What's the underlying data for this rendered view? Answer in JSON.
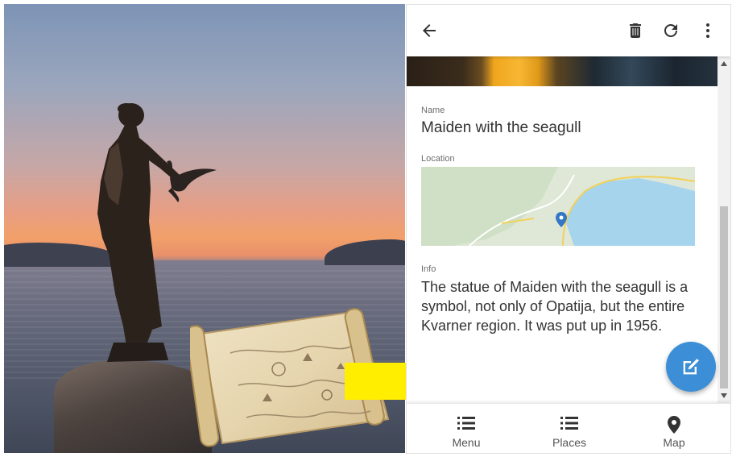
{
  "app": {
    "toolbar": {
      "back_icon": "arrow-left-icon",
      "delete_icon": "trash-icon",
      "refresh_icon": "refresh-icon",
      "more_icon": "more-vertical-icon"
    },
    "details": {
      "name_label": "Name",
      "name_value": "Maiden with the seagull",
      "location_label": "Location",
      "info_label": "Info",
      "info_text": "The statue of Maiden with the seagull is a symbol, not only of Opatija, but the entire Kvarner region. It was put up in 1956."
    },
    "fab_icon": "edit-icon",
    "bottom_nav": [
      {
        "label": "Menu",
        "icon": "list-icon"
      },
      {
        "label": "Places",
        "icon": "list-icon"
      },
      {
        "label": "Map",
        "icon": "map-pin-icon"
      }
    ]
  },
  "colors": {
    "accent": "#3c8fd6",
    "arrow": "#ffee00",
    "text_primary": "#333333",
    "text_secondary": "#6d6d6d"
  }
}
